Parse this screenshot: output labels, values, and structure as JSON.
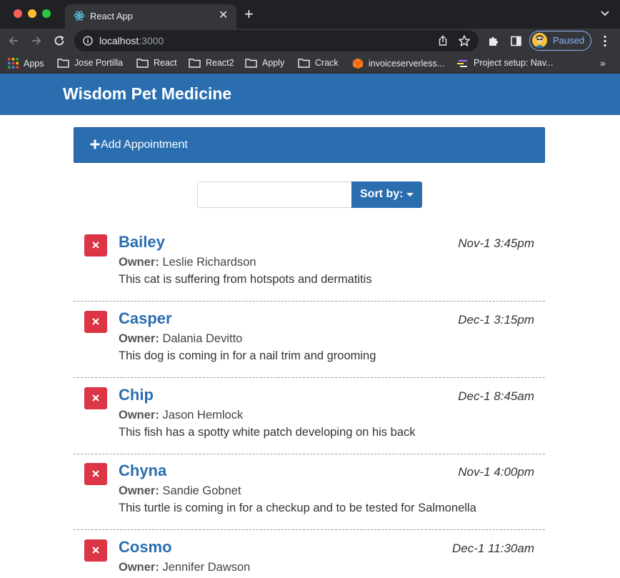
{
  "browser": {
    "tab_title": "React App",
    "url_host": "localhost",
    "url_port": ":3000",
    "profile_label": "Paused",
    "bookmarks": [
      {
        "label": "Apps",
        "icon": "apps-grid-icon"
      },
      {
        "label": "Jose Portilla",
        "icon": "folder-icon"
      },
      {
        "label": "React",
        "icon": "folder-icon"
      },
      {
        "label": "React2",
        "icon": "folder-icon"
      },
      {
        "label": "Apply",
        "icon": "folder-icon"
      },
      {
        "label": "Crack",
        "icon": "folder-icon"
      },
      {
        "label": "invoiceserverless...",
        "icon": "aws-cube-icon"
      },
      {
        "label": "Project setup: Nav...",
        "icon": "page-icon"
      }
    ],
    "more_bookmarks": "»"
  },
  "app": {
    "title": "Wisdom Pet Medicine",
    "add_label": "Add Appointment",
    "search_value": "",
    "sort_label": "Sort by:",
    "owner_key": "Owner:",
    "colors": {
      "header": "#2a6eb0",
      "pet_name": "#2a6eb0",
      "delete": "#dc3545"
    }
  },
  "appointments": [
    {
      "pet": "Bailey",
      "owner": "Leslie Richardson",
      "notes": "This cat is suffering from hotspots and dermatitis",
      "date": "Nov-1 3:45pm"
    },
    {
      "pet": "Casper",
      "owner": "Dalania Devitto",
      "notes": "This dog is coming in for a nail trim and grooming",
      "date": "Dec-1 3:15pm"
    },
    {
      "pet": "Chip",
      "owner": "Jason Hemlock",
      "notes": "This fish has a spotty white patch developing on his back",
      "date": "Dec-1 8:45am"
    },
    {
      "pet": "Chyna",
      "owner": "Sandie Gobnet",
      "notes": "This turtle is coming in for a checkup and to be tested for Salmonella",
      "date": "Nov-1 4:00pm"
    },
    {
      "pet": "Cosmo",
      "owner": "Jennifer Dawson",
      "notes": "",
      "date": "Dec-1 11:30am"
    }
  ]
}
